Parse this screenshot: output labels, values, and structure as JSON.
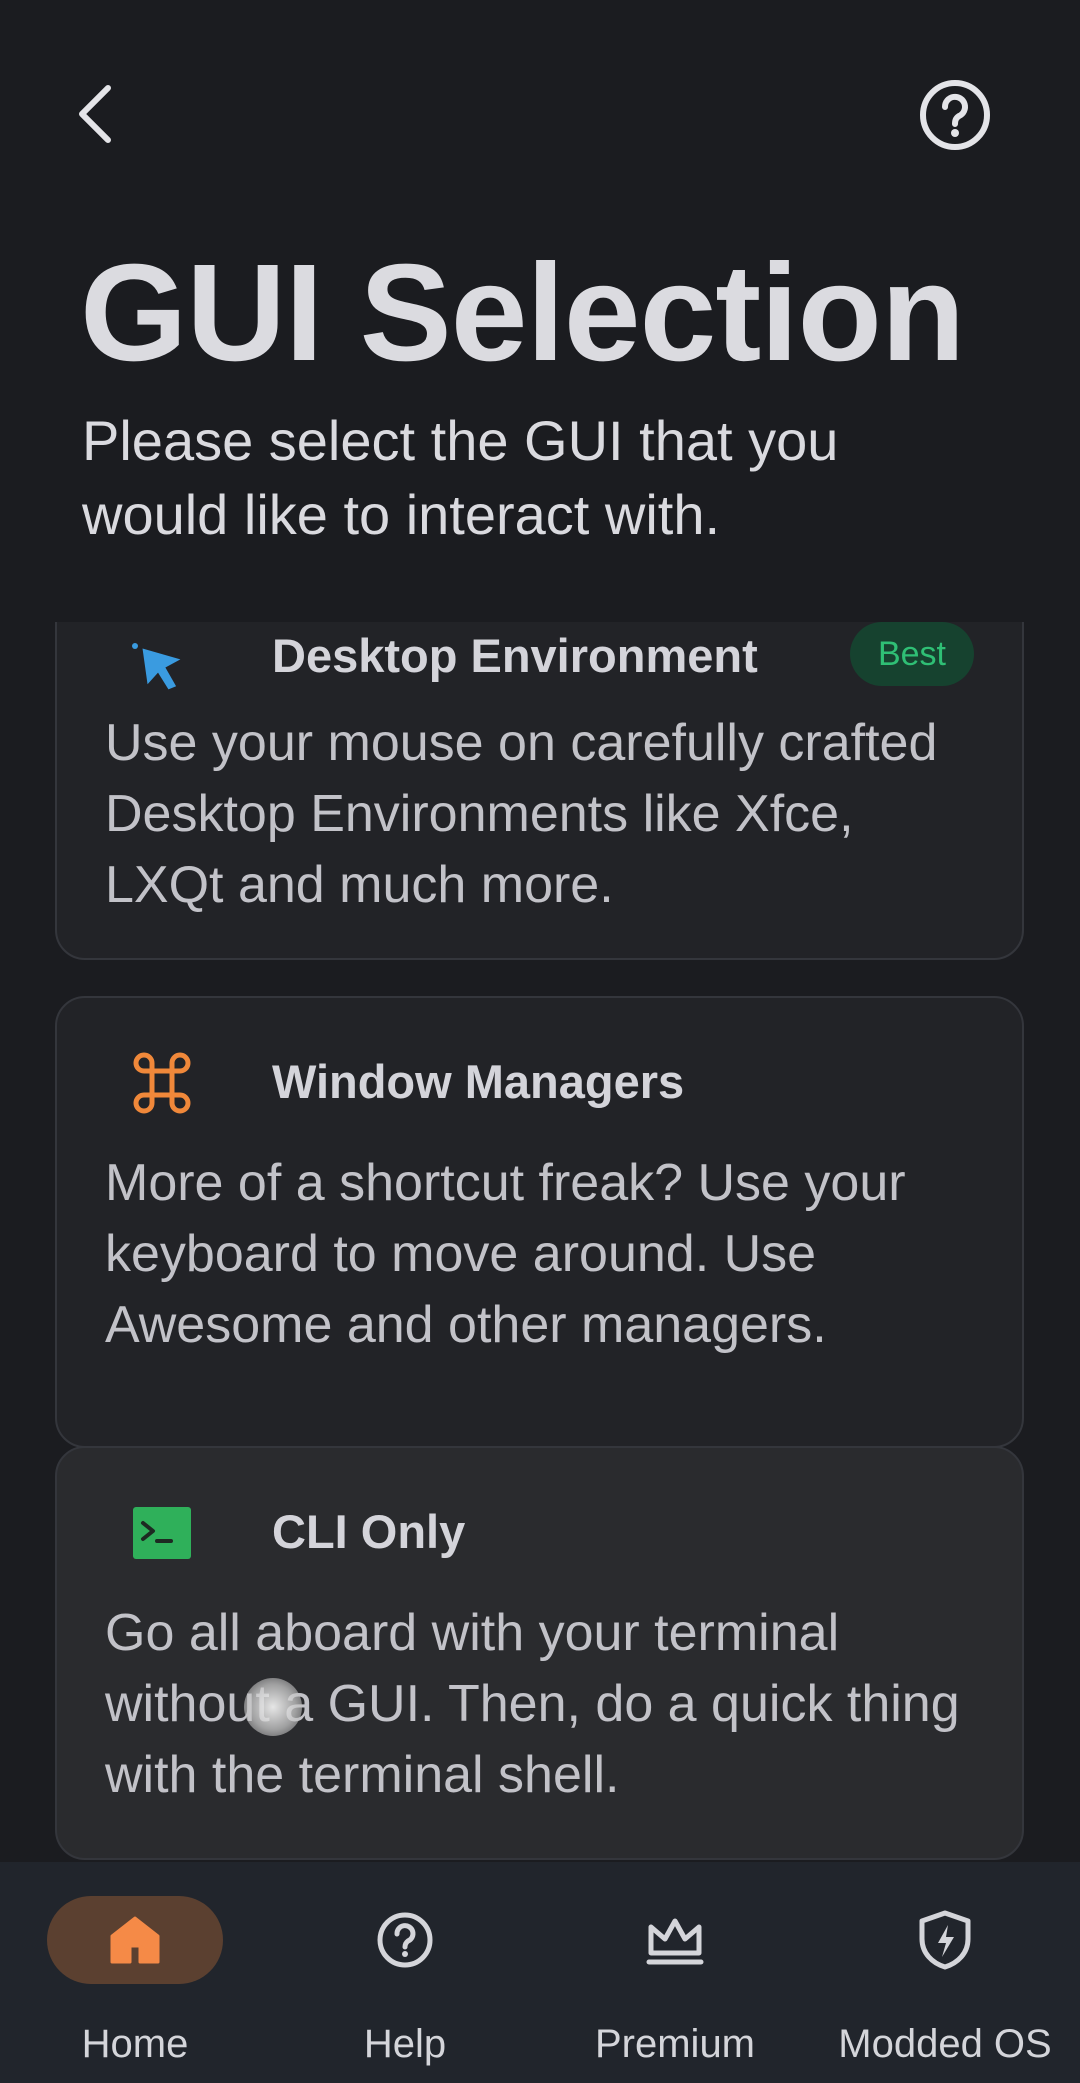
{
  "header": {
    "title": "GUI Selection",
    "subtitle": "Please select the GUI that you would like to interact with."
  },
  "options": [
    {
      "id": "desktop",
      "title": "Desktop Environment",
      "badge": "Best",
      "icon": "cursor-icon",
      "icon_color": "#3a9be0",
      "description": "Use your mouse on carefully crafted Desktop Environments like Xfce, LXQt and much more."
    },
    {
      "id": "wm",
      "title": "Window Managers",
      "icon": "command-key-icon",
      "icon_color": "#f0883a",
      "description": "More of a shortcut freak? Use your keyboard to move around. Use Awesome and other managers."
    },
    {
      "id": "cli",
      "title": "CLI Only",
      "icon": "terminal-icon",
      "icon_color": "#2fb05a",
      "description": "Go all aboard with your terminal without a GUI. Then, do a quick thing with the terminal shell."
    }
  ],
  "bottom_nav": [
    {
      "label": "Home",
      "icon": "home-icon",
      "active": true
    },
    {
      "label": "Help",
      "icon": "help-circle-icon",
      "active": false
    },
    {
      "label": "Premium",
      "icon": "crown-icon",
      "active": false
    },
    {
      "label": "Modded OS",
      "icon": "shield-bolt-icon",
      "active": false
    }
  ],
  "colors": {
    "background": "#1b1c20",
    "card_border": "#34363c",
    "nav_background": "#21252c",
    "active_pill": "#5b4030",
    "accent_orange": "#f58a47",
    "badge_bg": "#16422f",
    "badge_text": "#2fbf75"
  }
}
